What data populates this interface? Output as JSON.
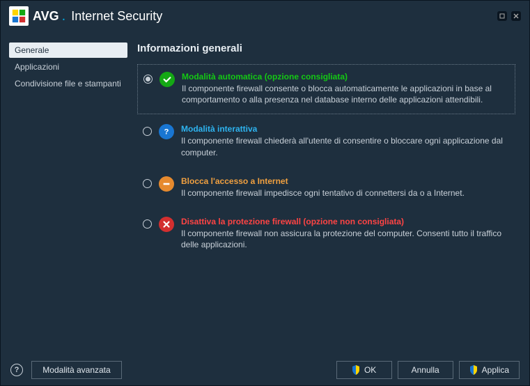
{
  "title": {
    "brand": "AVG",
    "product": "Internet Security"
  },
  "sidebar": {
    "items": [
      {
        "label": "Generale",
        "selected": true
      },
      {
        "label": "Applicazioni",
        "selected": false
      },
      {
        "label": "Condivisione file e stampanti",
        "selected": false
      }
    ]
  },
  "main": {
    "heading": "Informazioni generali",
    "options": [
      {
        "title": "Modalità automatica (opzione consigliata)",
        "desc": "Il componente firewall consente o blocca automaticamente le applicazioni in base al comportamento o alla presenza nel database interno delle applicazioni attendibili.",
        "selected": true,
        "icon": "check",
        "color": "green"
      },
      {
        "title": "Modalità interattiva",
        "desc": "Il componente firewall chiederà all'utente di consentire o bloccare ogni applicazione dal computer.",
        "selected": false,
        "icon": "question",
        "color": "blue"
      },
      {
        "title": "Blocca l'accesso a Internet",
        "desc": "Il componente firewall impedisce ogni tentativo di connettersi da o a Internet.",
        "selected": false,
        "icon": "minus",
        "color": "orange"
      },
      {
        "title": "Disattiva la protezione firewall (opzione non consigliata)",
        "desc": "Il componente firewall non assicura la protezione del computer. Consenti tutto il traffico delle applicazioni.",
        "selected": false,
        "icon": "cross",
        "color": "red"
      }
    ]
  },
  "footer": {
    "advanced": "Modalità avanzata",
    "ok": "OK",
    "cancel": "Annulla",
    "apply": "Applica"
  }
}
